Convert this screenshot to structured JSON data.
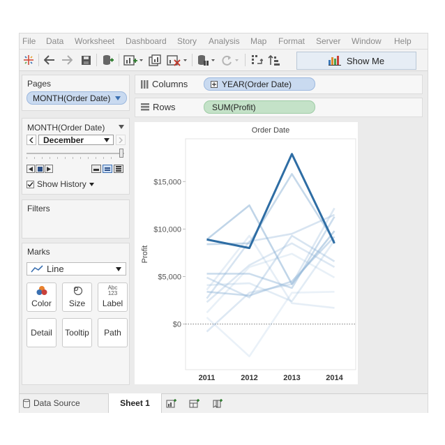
{
  "menu": [
    "File",
    "Data",
    "Worksheet",
    "Dashboard",
    "Story",
    "Analysis",
    "Map",
    "Format",
    "Server",
    "Window",
    "Help"
  ],
  "toolbar": {
    "show_me_label": "Show Me"
  },
  "pages": {
    "title": "Pages",
    "pill": "MONTH(Order Date)"
  },
  "page_control": {
    "title": "MONTH(Order Date)",
    "selected_month": "December",
    "show_history_label": "Show History",
    "show_history_checked": true
  },
  "filters": {
    "title": "Filters"
  },
  "marks": {
    "title": "Marks",
    "mark_type": "Line",
    "buttons": [
      "Color",
      "Size",
      "Label",
      "Detail",
      "Tooltip",
      "Path"
    ],
    "label_icon_text": "Abc\n123"
  },
  "shelves": {
    "columns_label": "Columns",
    "columns_pill": "YEAR(Order Date)",
    "rows_label": "Rows",
    "rows_pill": "SUM(Profit)"
  },
  "bottom": {
    "data_source_label": "Data Source",
    "sheet_tab": "Sheet 1"
  },
  "colors": {
    "highlight_line": "#2e6da4",
    "history_line": "#8db3d6",
    "pill_blue": "#c9daf0",
    "pill_green": "#c4e2c8"
  },
  "chart_data": {
    "type": "line",
    "title": "Order Date",
    "xlabel": "",
    "ylabel": "Profit",
    "categories": [
      "2011",
      "2012",
      "2013",
      "2014"
    ],
    "y_ticks": [
      "$15,000",
      "$10,000",
      "$5,000",
      "$0"
    ],
    "y_tick_values": [
      15000,
      10000,
      5000,
      0
    ],
    "ylim": [
      -4800,
      19500
    ],
    "zero_line": true,
    "grid": false,
    "highlighted_series": {
      "values": [
        8900,
        8000,
        17900,
        8500
      ]
    },
    "history_series": [
      {
        "values": [
          8900,
          12500,
          4200,
          9800
        ],
        "opacity": 0.55
      },
      {
        "values": [
          8400,
          8500,
          15800,
          8700
        ],
        "opacity": 0.5
      },
      {
        "values": [
          5300,
          5300,
          3800,
          11300
        ],
        "opacity": 0.45
      },
      {
        "values": [
          3400,
          3000,
          4500,
          9200
        ],
        "opacity": 0.45
      },
      {
        "values": [
          4900,
          2800,
          9300,
          6600
        ],
        "opacity": 0.35
      },
      {
        "values": [
          2700,
          8700,
          9500,
          11500
        ],
        "opacity": 0.35
      },
      {
        "values": [
          -800,
          3300,
          4200,
          12200
        ],
        "opacity": 0.3
      },
      {
        "values": [
          2300,
          6200,
          8500,
          6000
        ],
        "opacity": 0.3
      },
      {
        "values": [
          4100,
          4300,
          2400,
          8800
        ],
        "opacity": 0.25
      },
      {
        "values": [
          3600,
          9300,
          2200,
          1700
        ],
        "opacity": 0.22
      },
      {
        "values": [
          700,
          -3400,
          3300,
          3400
        ],
        "opacity": 0.18
      },
      {
        "values": [
          1200,
          6000,
          7400,
          4900
        ],
        "opacity": 0.2
      }
    ]
  }
}
